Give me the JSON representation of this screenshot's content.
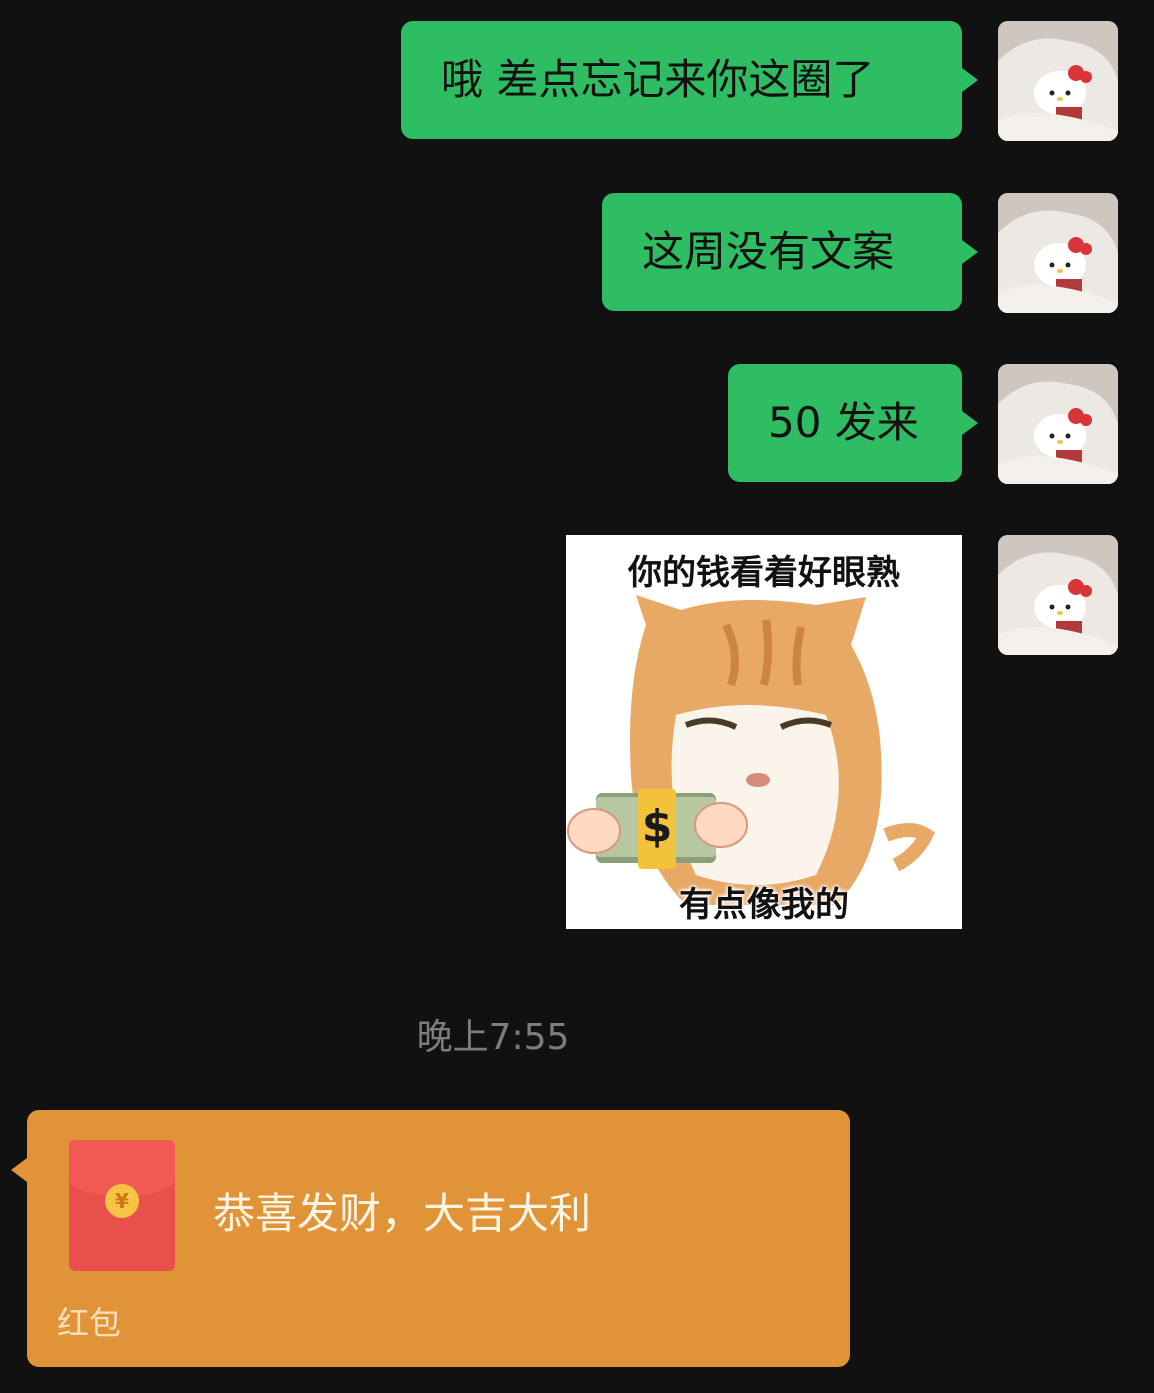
{
  "messages": [
    {
      "text": "哦 差点忘记来你这圈了"
    },
    {
      "text": "这周没有文案"
    },
    {
      "text": "50 发来"
    }
  ],
  "sticker": {
    "top_caption": "你的钱看着好眼熟",
    "bottom_caption": "有点像我的"
  },
  "timestamp": "晚上7:55",
  "red_packet": {
    "title": "恭喜发财，大吉大利",
    "label": "红包",
    "coin_symbol": "¥"
  },
  "colors": {
    "background": "#111111",
    "sent_bubble": "#2ebd62",
    "red_packet_bubble": "#e19337",
    "red_packet_envelope": "#e9504c"
  },
  "icons": {
    "avatar": "hello-kitty-avatar",
    "coin": "yuan-coin-icon"
  }
}
